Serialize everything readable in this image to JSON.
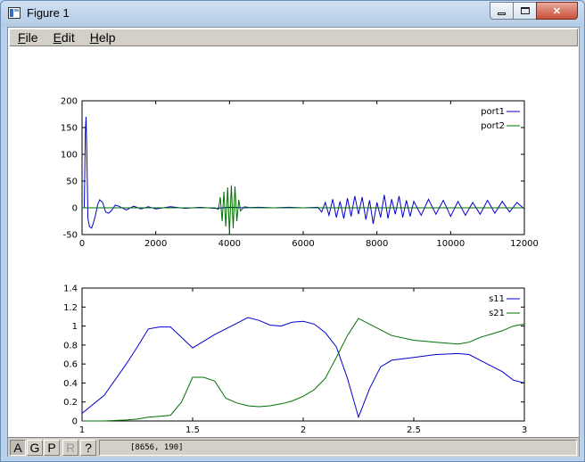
{
  "window": {
    "title": "Figure 1",
    "controls": {
      "minimize": "minimize",
      "maximize": "maximize",
      "close": "✕"
    }
  },
  "menu": [
    {
      "label": "File",
      "hotkey": "F",
      "rest": "ile"
    },
    {
      "label": "Edit",
      "hotkey": "E",
      "rest": "dit"
    },
    {
      "label": "Help",
      "hotkey": "H",
      "rest": "elp"
    }
  ],
  "toolbar": {
    "buttons": [
      {
        "label": "A",
        "state": "pressed"
      },
      {
        "label": "G",
        "state": "normal"
      },
      {
        "label": "P",
        "state": "normal"
      },
      {
        "label": "R",
        "state": "disabled"
      },
      {
        "label": "?",
        "state": "normal"
      }
    ],
    "coordinates": "[8656, 190]"
  },
  "chart_data": [
    {
      "type": "line",
      "title": "",
      "xlabel": "",
      "ylabel": "",
      "xlim": [
        0,
        12000
      ],
      "ylim": [
        -50,
        200
      ],
      "xticks": [
        0,
        2000,
        4000,
        6000,
        8000,
        10000,
        12000
      ],
      "yticks": [
        -50,
        0,
        50,
        100,
        150,
        200
      ],
      "grid": false,
      "legend": "top-right",
      "series": [
        {
          "name": "port1",
          "color": "#0000cc",
          "description": "sharp spike near t=100 reaching ~170, ringing decaying after; burst of oscillations 6500-12000 with amplitude ~ +/-20",
          "x": [
            0,
            60,
            90,
            110,
            130,
            160,
            200,
            260,
            300,
            360,
            420,
            480,
            560,
            640,
            720,
            800,
            900,
            1000,
            1200,
            1400,
            1600,
            1800,
            2000,
            2400,
            2800,
            3200,
            3600,
            4000,
            4400,
            4800,
            5200,
            5600,
            6000,
            6400,
            6500,
            6600,
            6700,
            6800,
            6900,
            7000,
            7100,
            7200,
            7300,
            7400,
            7500,
            7600,
            7700,
            7800,
            7900,
            8000,
            8100,
            8200,
            8300,
            8400,
            8500,
            8600,
            8700,
            8800,
            8900,
            9000,
            9200,
            9400,
            9600,
            9800,
            10000,
            10200,
            10400,
            10600,
            10800,
            11000,
            11200,
            11400,
            11600,
            11800,
            12000
          ],
          "y": [
            0,
            0,
            140,
            170,
            100,
            -20,
            -35,
            -38,
            -30,
            -15,
            5,
            15,
            10,
            -8,
            -10,
            -5,
            5,
            3,
            -4,
            3,
            -2,
            2,
            -2,
            2,
            -1,
            1,
            -1,
            1,
            0,
            1,
            0,
            1,
            0,
            1,
            -8,
            10,
            -14,
            16,
            -18,
            12,
            -20,
            18,
            -16,
            22,
            -12,
            20,
            -22,
            14,
            -30,
            10,
            -18,
            24,
            -20,
            16,
            -12,
            22,
            -18,
            14,
            -16,
            12,
            -14,
            16,
            -12,
            14,
            -16,
            12,
            -14,
            10,
            -12,
            14,
            -10,
            12,
            -8,
            10,
            -2
          ]
        },
        {
          "name": "port2",
          "color": "#007000",
          "description": "flat near zero except oscillation burst around 3700-4300 with amplitude ~ +/-45",
          "x": [
            0,
            1000,
            2000,
            3000,
            3600,
            3700,
            3750,
            3800,
            3850,
            3900,
            3950,
            4000,
            4050,
            4100,
            4150,
            4200,
            4250,
            4300,
            4400,
            4600,
            5000,
            6000,
            8000,
            10000,
            12000
          ],
          "y": [
            0,
            0,
            0,
            0,
            0,
            -3,
            20,
            -25,
            30,
            -35,
            38,
            -48,
            42,
            -38,
            40,
            -25,
            15,
            -6,
            2,
            0,
            0,
            0,
            0,
            0,
            0
          ]
        }
      ]
    },
    {
      "type": "line",
      "title": "",
      "xlabel": "",
      "ylabel": "",
      "xlim": [
        1,
        3
      ],
      "ylim": [
        0,
        1.4
      ],
      "xticks": [
        1,
        1.5,
        2,
        2.5,
        3
      ],
      "yticks": [
        0,
        0.2,
        0.4,
        0.6,
        0.8,
        1,
        1.2,
        1.4
      ],
      "xticklabels": [
        "1",
        "1.5",
        "2",
        "2.5",
        "3"
      ],
      "grid": false,
      "legend": "top-right",
      "series": [
        {
          "name": "s11",
          "color": "#0000cc",
          "x": [
            1.0,
            1.1,
            1.2,
            1.25,
            1.3,
            1.35,
            1.4,
            1.45,
            1.5,
            1.6,
            1.7,
            1.75,
            1.8,
            1.85,
            1.9,
            1.95,
            2.0,
            2.05,
            2.1,
            2.15,
            2.2,
            2.25,
            2.3,
            2.35,
            2.4,
            2.5,
            2.6,
            2.7,
            2.75,
            2.8,
            2.9,
            2.95,
            3.0
          ],
          "y": [
            0.08,
            0.27,
            0.6,
            0.78,
            0.97,
            0.99,
            0.99,
            0.88,
            0.77,
            0.91,
            1.03,
            1.09,
            1.06,
            1.01,
            1.0,
            1.04,
            1.05,
            1.02,
            0.93,
            0.78,
            0.45,
            0.04,
            0.34,
            0.57,
            0.64,
            0.67,
            0.7,
            0.71,
            0.7,
            0.64,
            0.52,
            0.43,
            0.4
          ]
        },
        {
          "name": "s21",
          "color": "#007000",
          "x": [
            1.0,
            1.1,
            1.2,
            1.25,
            1.3,
            1.35,
            1.4,
            1.45,
            1.5,
            1.55,
            1.6,
            1.65,
            1.7,
            1.75,
            1.8,
            1.85,
            1.9,
            1.95,
            2.0,
            2.05,
            2.1,
            2.15,
            2.2,
            2.25,
            2.3,
            2.35,
            2.4,
            2.5,
            2.6,
            2.7,
            2.75,
            2.8,
            2.9,
            2.95,
            3.0
          ],
          "y": [
            0.0,
            0.0,
            0.01,
            0.02,
            0.04,
            0.05,
            0.06,
            0.2,
            0.46,
            0.46,
            0.42,
            0.24,
            0.19,
            0.16,
            0.15,
            0.16,
            0.18,
            0.21,
            0.26,
            0.33,
            0.45,
            0.67,
            0.9,
            1.08,
            1.02,
            0.96,
            0.9,
            0.85,
            0.83,
            0.81,
            0.83,
            0.88,
            0.95,
            1.0,
            1.02
          ]
        }
      ]
    }
  ]
}
